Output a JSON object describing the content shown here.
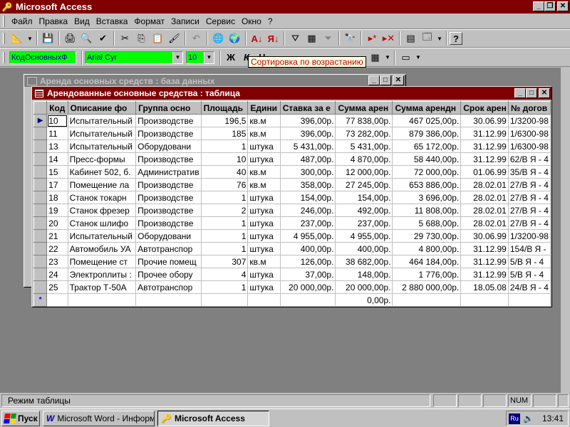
{
  "app": {
    "title": "Microsoft Access"
  },
  "menu": [
    "Файл",
    "Правка",
    "Вид",
    "Вставка",
    "Формат",
    "Записи",
    "Сервис",
    "Окно",
    "?"
  ],
  "formatting": {
    "field": "КодОсновныхФ",
    "font": "Arial Cyr",
    "size": "10",
    "bold": "Ж",
    "italic": "К",
    "underline": "Ч"
  },
  "tooltip": "Сортировка по возрастанию",
  "db_window": {
    "title": "Аренда основных средств : база данных"
  },
  "table_window": {
    "title": "Арендованные основные средства : таблица",
    "columns": [
      "Код",
      "Описание фо",
      "Группа осно",
      "Площадь",
      "Едини",
      "Ставка за е",
      "Сумма арен",
      "Сумма арендн",
      "Срок арен",
      "№ догов"
    ],
    "rows": [
      [
        "10",
        "Испытательный",
        "Производстве",
        "196,5",
        "кв.м",
        "396,00р.",
        "77 838,00р.",
        "467 025,00р.",
        "30.06.99",
        "1/3200-98"
      ],
      [
        "11",
        "Испытательный",
        "Производстве",
        "185",
        "кв.м",
        "396,00р.",
        "73 282,00р.",
        "879 386,00р.",
        "31.12.99",
        "1/6300-98"
      ],
      [
        "13",
        "Испытательный",
        "Оборудовани",
        "1",
        "штука",
        "5 431,00р.",
        "5 431,00р.",
        "65 172,00р.",
        "31.12.99",
        "1/6300-98"
      ],
      [
        "14",
        "Пресс-формы",
        "Производстве",
        "10",
        "штука",
        "487,00р.",
        "4 870,00р.",
        "58 440,00р.",
        "31.12.99",
        "62/В Я - 4"
      ],
      [
        "15",
        "Кабинет 502, б.",
        "Административ",
        "40",
        "кв.м",
        "300,00р.",
        "12 000,00р.",
        "72 000,00р.",
        "01.06.99",
        "35/В Я - 4"
      ],
      [
        "17",
        "Помещение ла",
        "Производстве",
        "76",
        "кв.м",
        "358,00р.",
        "27 245,00р.",
        "653 886,00р.",
        "28.02.01",
        "27/В Я - 4"
      ],
      [
        "18",
        "Станок токарн",
        "Производстве",
        "1",
        "штука",
        "154,00р.",
        "154,00р.",
        "3 696,00р.",
        "28.02.01",
        "27/В Я - 4"
      ],
      [
        "19",
        "Станок фрезер",
        "Производстве",
        "2",
        "штука",
        "246,00р.",
        "492,00р.",
        "11 808,00р.",
        "28.02.01",
        "27/В Я - 4"
      ],
      [
        "20",
        "Станок шлифо",
        "Производстве",
        "1",
        "штука",
        "237,00р.",
        "237,00р.",
        "5 688,00р.",
        "28.02.01",
        "27/В Я - 4"
      ],
      [
        "21",
        "Испытательный",
        "Оборудовани",
        "1",
        "штука",
        "4 955,00р.",
        "4 955,00р.",
        "29 730,00р.",
        "30.06.99",
        "1/3200-98"
      ],
      [
        "22",
        "Автомобиль УА",
        "Автотранспор",
        "1",
        "штука",
        "400,00р.",
        "400,00р.",
        "4 800,00р.",
        "31.12.99",
        "154/В Я -"
      ],
      [
        "23",
        "Помещение ст",
        "Прочие помещ",
        "307",
        "кв.м",
        "126,00р.",
        "38 682,00р.",
        "464 184,00р.",
        "31.12.99",
        "5/В Я - 4"
      ],
      [
        "24",
        "Электроплиты :",
        "Прочее обору",
        "4",
        "штука",
        "37,00р.",
        "148,00р.",
        "1 776,00р.",
        "31.12.99",
        "5/В Я - 4"
      ],
      [
        "25",
        "Трактор Т-50А",
        "Автотранспор",
        "1",
        "штука",
        "20 000,00р.",
        "20 000,00р.",
        "2 880 000,00р.",
        "18.05.08",
        "24/В Я - 4"
      ]
    ],
    "new_row": {
      "marker": "*",
      "sum_default": "0,00р."
    }
  },
  "status": {
    "mode": "Режим таблицы",
    "num": "NUM"
  },
  "taskbar": {
    "start": "Пуск",
    "tasks": [
      {
        "label": "Microsoft Word - Информ...",
        "active": false
      },
      {
        "label": "Microsoft Access",
        "active": true
      }
    ],
    "lang": "Ru",
    "clock": "13:41"
  }
}
